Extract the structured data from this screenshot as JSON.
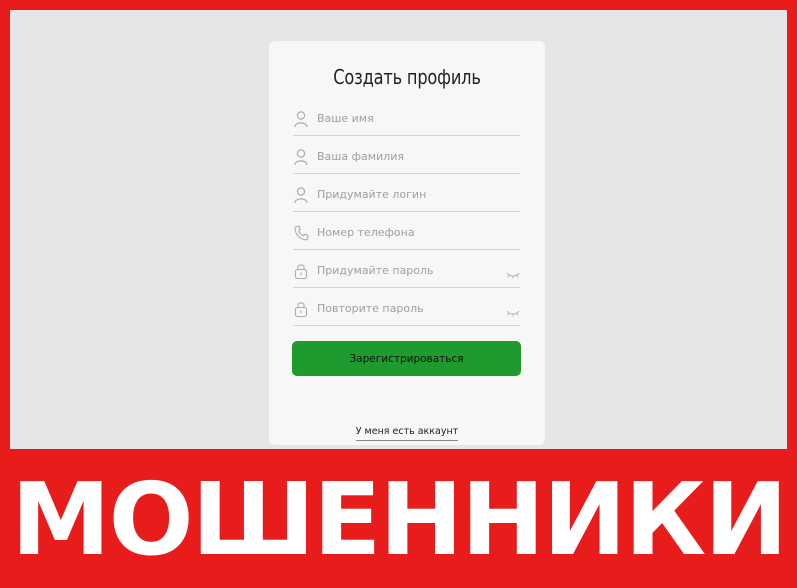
{
  "form": {
    "title": "Создать профиль",
    "fields": [
      {
        "placeholder": "Ваше имя",
        "icon": "user-icon"
      },
      {
        "placeholder": "Ваша фамилия",
        "icon": "user-icon"
      },
      {
        "placeholder": "Придумайте логин",
        "icon": "user-icon"
      },
      {
        "placeholder": "Номер телефона",
        "icon": "phone-icon"
      },
      {
        "placeholder": "Придумайте пароль",
        "icon": "lock-icon",
        "toggle_icon": "eye-closed-icon"
      },
      {
        "placeholder": "Повторите пароль",
        "icon": "lock-icon",
        "toggle_icon": "eye-closed-icon"
      }
    ],
    "submit_label": "Зарегистрироваться",
    "login_link": "У меня есть аккаунт"
  },
  "banner": {
    "text": "МОШЕННИКИ"
  },
  "colors": {
    "frame": "#e91c1c",
    "button": "#1f9a2e",
    "background": "#e6e6e6",
    "card": "#f7f7f7"
  }
}
